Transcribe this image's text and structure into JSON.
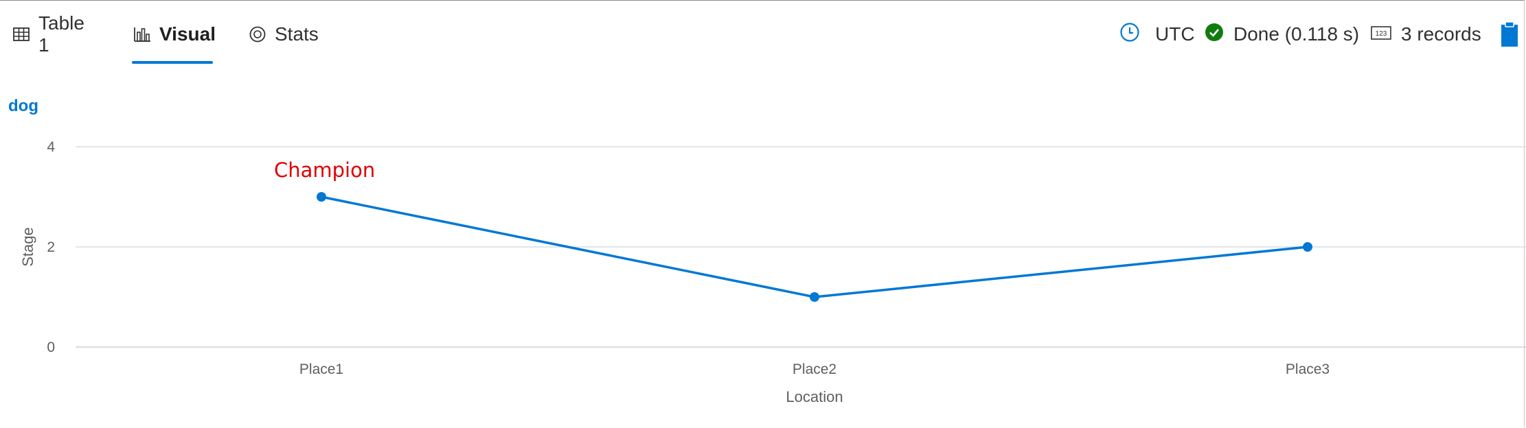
{
  "tabs": [
    {
      "label": "Table 1",
      "icon": "table-icon",
      "active": false
    },
    {
      "label": "Visual",
      "icon": "chart-icon",
      "active": true
    },
    {
      "label": "Stats",
      "icon": "stats-icon",
      "active": false
    }
  ],
  "status": {
    "timezone": "UTC",
    "done_text": "Done (0.118 s)",
    "records_text": "3 records",
    "icons": [
      "clock-icon",
      "check-circle-icon",
      "records-icon",
      "clipboard-icon"
    ]
  },
  "colors": {
    "accent": "#0078d4",
    "success": "#107c10",
    "annotation": "#e00000",
    "gridline": "#d6dde2"
  },
  "chart_data": {
    "type": "line",
    "categories": [
      "Place1",
      "Place2",
      "Place3"
    ],
    "series": [
      {
        "name": "dog",
        "values": [
          3,
          1,
          2
        ]
      }
    ],
    "xlabel": "Location",
    "ylabel": "Stage",
    "ylim": [
      0,
      4
    ],
    "yticks": [
      0,
      2,
      4
    ],
    "grid": true,
    "legend": "top-left",
    "annotations": [
      {
        "text": "Champion",
        "category": "Place1"
      }
    ]
  }
}
